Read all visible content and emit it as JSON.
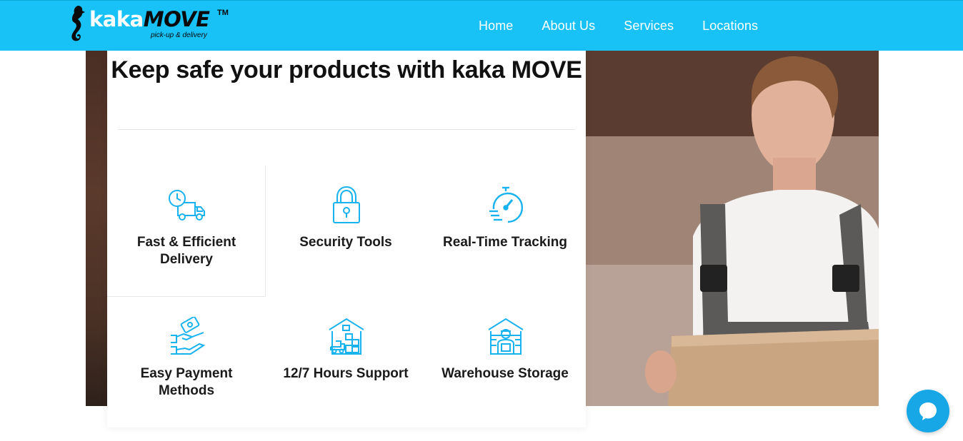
{
  "brand": {
    "name_light": "kaka",
    "name_dark": "MOVE",
    "trademark": "TM",
    "tagline": "pick-up & delivery",
    "icon": "seahorse-icon",
    "color": "#18c1f6"
  },
  "nav": {
    "items": [
      {
        "label": "Home"
      },
      {
        "label": "About Us"
      },
      {
        "label": "Services"
      },
      {
        "label": "Locations"
      }
    ]
  },
  "hero": {
    "title": "Keep safe your products with kaka MOVE",
    "features": [
      {
        "label": "Fast & Efficient Delivery",
        "icon": "delivery-truck-clock-icon"
      },
      {
        "label": "Security Tools",
        "icon": "padlock-icon"
      },
      {
        "label": "Real-Time Tracking",
        "icon": "stopwatch-icon"
      },
      {
        "label": "Easy Payment Methods",
        "icon": "hand-money-icon"
      },
      {
        "label": "12/7 Hours Support",
        "icon": "warehouse-boxes-icon"
      },
      {
        "label": "Warehouse Storage",
        "icon": "warehouse-worker-icon"
      }
    ]
  },
  "chat": {
    "icon": "chat-bubble-icon"
  }
}
